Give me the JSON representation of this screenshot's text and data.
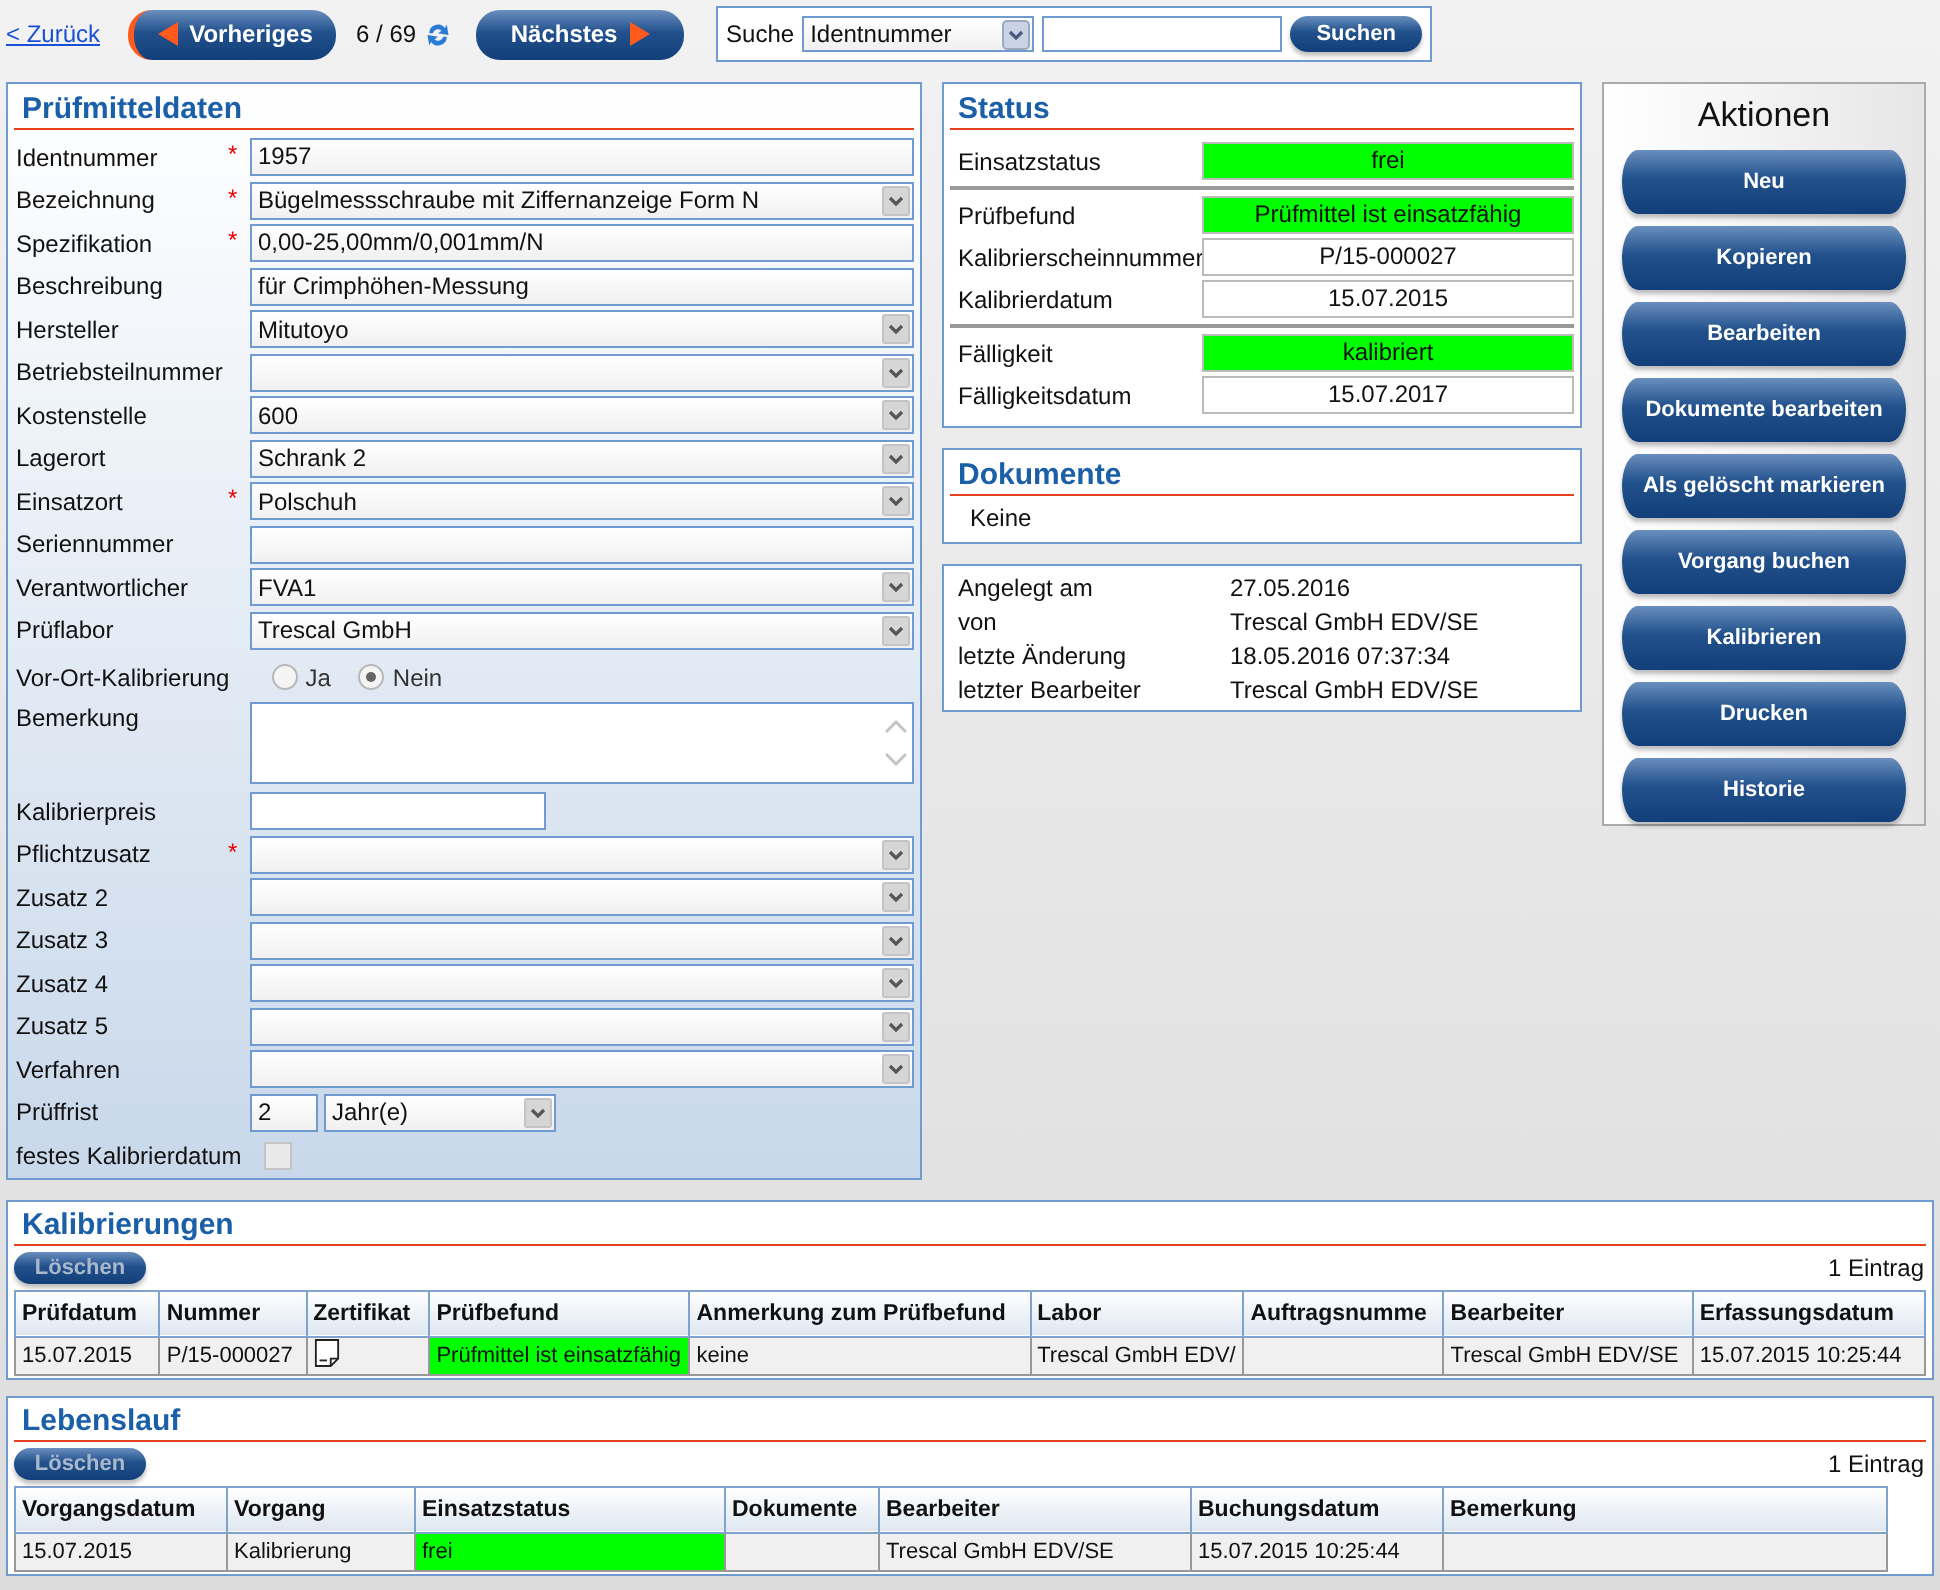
{
  "nav": {
    "back": "< Zurück",
    "previous": "Vorheriges",
    "position": "6 / 69",
    "next": "Nächstes"
  },
  "search": {
    "label": "Suche",
    "field": "Identnummer",
    "button": "Suchen"
  },
  "form": {
    "title": "Prüfmitteldaten",
    "fields": [
      {
        "label": "Identnummer",
        "marker": "*",
        "kind": "text",
        "value": "1957"
      },
      {
        "label": "Bezeichnung",
        "marker": "*",
        "kind": "select",
        "value": "Bügelmessschraube mit Ziffernanzeige Form N"
      },
      {
        "label": "Spezifikation",
        "marker": "*",
        "kind": "text",
        "value": "0,00-25,00mm/0,001mm/N"
      },
      {
        "label": "Beschreibung",
        "kind": "text",
        "value": "für Crimphöhen-Messung"
      },
      {
        "label": "Hersteller",
        "kind": "select",
        "value": "Mitutoyo"
      },
      {
        "label": "Betriebsteilnummer",
        "kind": "select"
      },
      {
        "label": "Kostenstelle",
        "kind": "select",
        "value": "600"
      },
      {
        "label": "Lagerort",
        "kind": "select",
        "value": "Schrank 2"
      },
      {
        "label": "Einsatzort",
        "marker": "*",
        "kind": "select",
        "value": "Polschuh"
      },
      {
        "label": "Seriennummer",
        "kind": "text"
      },
      {
        "label": "Verantwortlicher",
        "kind": "select",
        "value": "FVA1"
      },
      {
        "label": "Prüflabor",
        "kind": "select",
        "value": "Trescal GmbH"
      },
      {
        "label": "Vor-Ort-Kalibrierung",
        "kind": "radio",
        "options": [
          {
            "label": "Ja",
            "selected": false
          },
          {
            "label": "Nein",
            "selected": true
          }
        ]
      },
      {
        "label": "Bemerkung",
        "kind": "textarea"
      },
      {
        "label": "Kalibrierpreis",
        "kind": "short"
      },
      {
        "label": "Pflichtzusatz",
        "marker": "*",
        "kind": "select"
      },
      {
        "label": "Zusatz 2",
        "kind": "select"
      },
      {
        "label": "Zusatz 3",
        "kind": "select"
      },
      {
        "label": "Zusatz 4",
        "kind": "select"
      },
      {
        "label": "Zusatz 5",
        "kind": "select"
      },
      {
        "label": "Verfahren",
        "kind": "select"
      },
      {
        "label": "Prüffrist",
        "kind": "period",
        "value": "2",
        "unit": "Jahr(e)"
      },
      {
        "label": "festes Kalibrierdatum",
        "kind": "checkbox",
        "checked": false
      }
    ]
  },
  "status": {
    "title": "Status",
    "groups": [
      [
        {
          "label": "Einsatzstatus",
          "value": "frei",
          "highlight": true
        }
      ],
      [
        {
          "label": "Prüfbefund",
          "value": "Prüfmittel ist einsatzfähig",
          "highlight": true
        },
        {
          "label": "Kalibrierscheinnummer",
          "value": "P/15-000027",
          "highlight": false
        },
        {
          "label": "Kalibrierdatum",
          "value": "15.07.2015",
          "highlight": false
        }
      ],
      [
        {
          "label": "Fälligkeit",
          "value": "kalibriert",
          "highlight": true
        },
        {
          "label": "Fälligkeitsdatum",
          "value": "15.07.2017",
          "highlight": false
        }
      ]
    ]
  },
  "documents": {
    "title": "Dokumente",
    "text": "Keine"
  },
  "record_info": [
    {
      "label": "Angelegt am",
      "value": "27.05.2016"
    },
    {
      "label": "von",
      "value": "Trescal GmbH EDV/SE"
    },
    {
      "label": "letzte Änderung",
      "value": "18.05.2016 07:37:34"
    },
    {
      "label": "letzter Bearbeiter",
      "value": "Trescal GmbH EDV/SE"
    }
  ],
  "actions": {
    "title": "Aktionen",
    "buttons": [
      "Neu",
      "Kopieren",
      "Bearbeiten",
      "Dokumente bearbeiten",
      "Als gelöscht markieren",
      "Vorgang buchen",
      "Kalibrieren",
      "Drucken",
      "Historie"
    ]
  },
  "tables": [
    {
      "title": "Kalibrierungen",
      "delete_button": {
        "label": "Löschen",
        "disabled": true
      },
      "count": "1 Eintrag",
      "columns": [
        "Prüfdatum",
        "Nummer",
        "Zertifikat",
        "Prüfbefund",
        "Anmerkung zum Prüfbefund",
        "Labor",
        "Auftragsnumme",
        "Bearbeiter",
        "Erfassungsdatum"
      ],
      "rows": [
        [
          {
            "kind": "text",
            "text": "15.07.2015",
            "highlight": false
          },
          {
            "kind": "text",
            "text": "P/15-000027",
            "highlight": false
          },
          {
            "kind": "icon"
          },
          {
            "kind": "text",
            "text": "Prüfmittel ist einsatzfähig",
            "highlight": true
          },
          {
            "kind": "text",
            "text": "keine",
            "highlight": false
          },
          {
            "kind": "text",
            "text": "Trescal GmbH EDV/",
            "highlight": false
          },
          {
            "kind": "text",
            "highlight": false
          },
          {
            "kind": "text",
            "text": "Trescal GmbH EDV/SE",
            "highlight": false
          },
          {
            "kind": "text",
            "text": "15.07.2015 10:25:44",
            "highlight": false
          }
        ]
      ]
    },
    {
      "title": "Lebenslauf",
      "delete_button": {
        "label": "Löschen",
        "disabled": true
      },
      "count": "1 Eintrag",
      "columns": [
        "Vorgangsdatum",
        "Vorgang",
        "Einsatzstatus",
        "Dokumente",
        "Bearbeiter",
        "Buchungsdatum",
        "Bemerkung"
      ],
      "rows": [
        [
          {
            "kind": "text",
            "text": "15.07.2015",
            "highlight": false
          },
          {
            "kind": "text",
            "text": "Kalibrierung",
            "highlight": false
          },
          {
            "kind": "text",
            "text": "frei",
            "highlight": true
          },
          {
            "kind": "text",
            "highlight": false
          },
          {
            "kind": "text",
            "text": "Trescal GmbH EDV/SE",
            "highlight": false
          },
          {
            "kind": "text",
            "text": "15.07.2015 10:25:44",
            "highlight": false
          },
          {
            "kind": "text",
            "highlight": false
          }
        ]
      ]
    }
  ]
}
